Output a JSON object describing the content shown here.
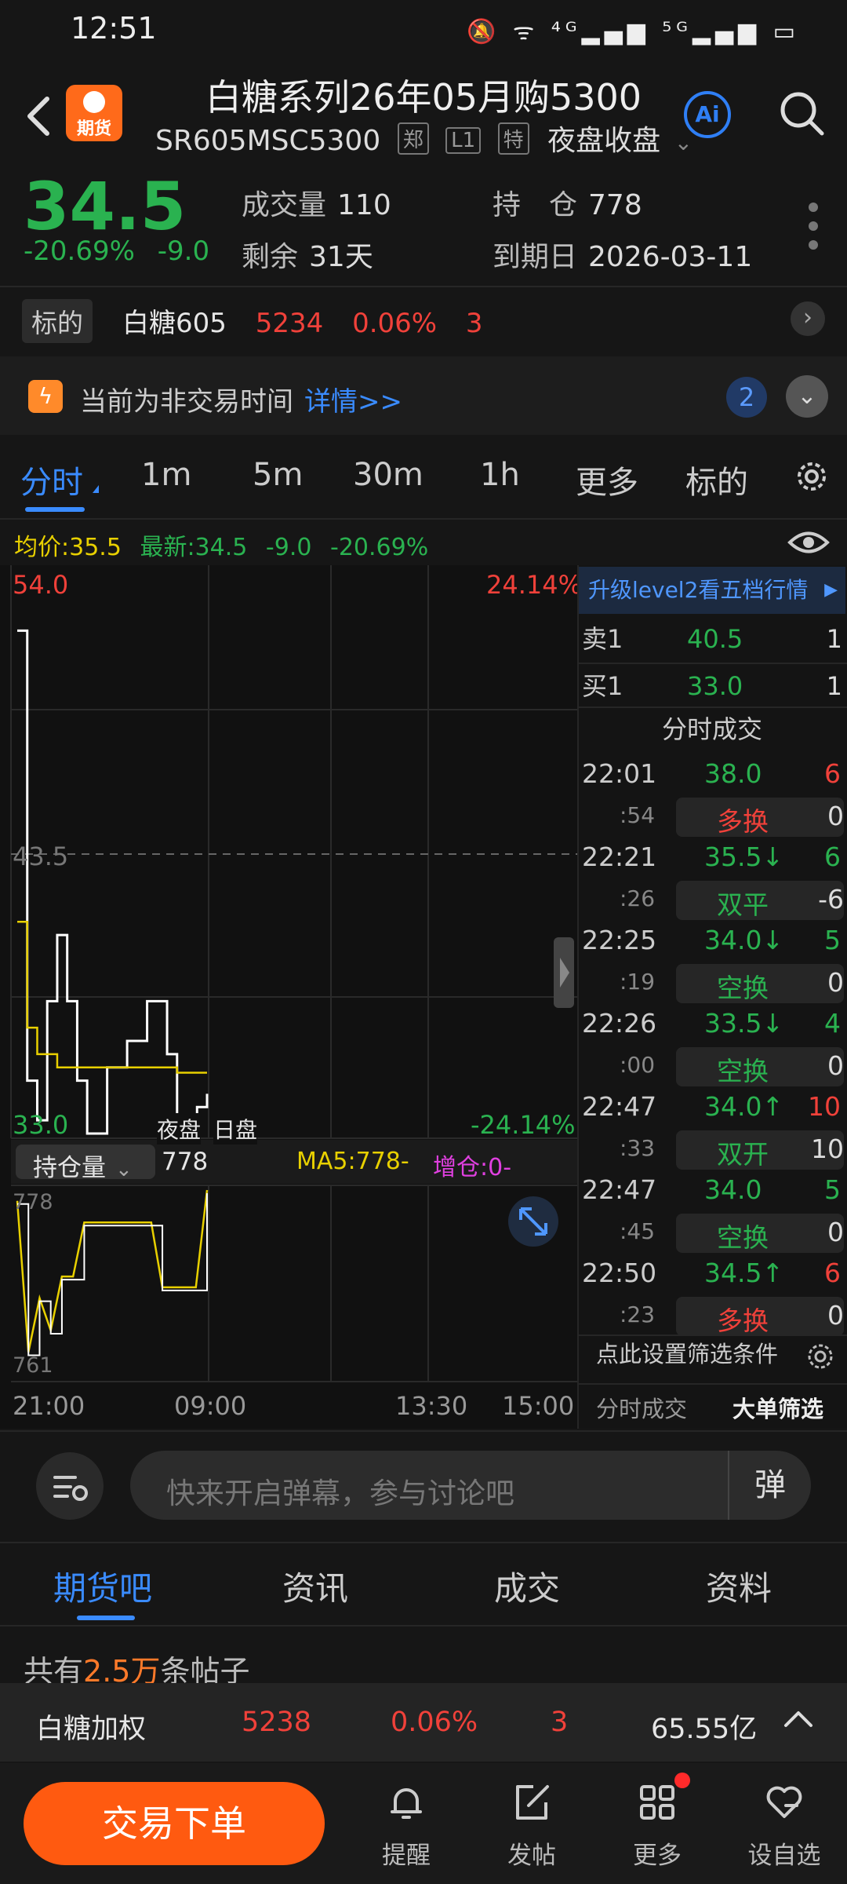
{
  "status_bar": {
    "time": "12:51",
    "icons": "🔕 ᯤ ⁴ᴳ▂▄▆ ⁵ᴳ▂▄▆ ▭"
  },
  "header": {
    "logo_text": "期货",
    "title": "白糖系列26年05月购5300",
    "code": "SR605MSC5300",
    "tags": [
      "郑",
      "L1",
      "特"
    ],
    "session": "夜盘收盘",
    "ai_label": "Ai"
  },
  "quote": {
    "price": "34.5",
    "change_pct": "-20.69%",
    "change": "-9.0",
    "volume_label": "成交量",
    "volume": "110",
    "oi_label": "持　仓",
    "oi": "778",
    "remaining_label": "剩余",
    "remaining": "31天",
    "expiry_label": "到期日",
    "expiry": "2026-03-11"
  },
  "underlying": {
    "tag": "标的",
    "name": "白糖605",
    "price": "5234",
    "pct": "0.06%",
    "change": "3"
  },
  "notice": {
    "text": "当前为非交易时间",
    "link": "详情>>",
    "badge": "2"
  },
  "period_tabs": [
    {
      "label": "分时"
    },
    {
      "label": "1m"
    },
    {
      "label": "5m"
    },
    {
      "label": "30m"
    },
    {
      "label": "1h"
    },
    {
      "label": "更多"
    },
    {
      "label": "标的"
    }
  ],
  "avg_line": {
    "avg": "均价:35.5",
    "latest": "最新:34.5",
    "change": "-9.0",
    "pct": "-20.69%"
  },
  "chart": {
    "top_left": "54.0",
    "top_right": "24.14%",
    "mid": "43.5",
    "bottom_left": "33.0",
    "bottom_right": "-24.14%",
    "session_night": "夜盘",
    "session_day": "日盘",
    "sub_selector": "持仓量",
    "sub_value": "778",
    "ma5": "MA5:778-",
    "zengcang": "增仓:0-",
    "sub_top": "778",
    "sub_bottom": "761",
    "x_labels": [
      "21:00",
      "09:00",
      "13:30",
      "15:00"
    ],
    "colors": {
      "price": "#ffffff",
      "avg": "#e8d000",
      "up": "#f0413a",
      "down": "#2ab250"
    }
  },
  "chart_data": {
    "type": "line",
    "title": "",
    "ylim": [
      33.0,
      54.0
    ],
    "reference": 43.5,
    "series": [
      {
        "values": [
          52.0,
          35.0,
          33.5,
          38.0,
          40.5,
          38.0,
          35.0,
          33.0,
          33.0,
          35.5,
          35.5,
          36.5,
          36.5,
          38.0,
          38.0,
          36.0,
          33.5,
          33.0,
          34.0,
          34.5
        ]
      },
      {
        "values": [
          41.0,
          37.0,
          36.0,
          36.0,
          35.5,
          35.5,
          35.5,
          35.5,
          35.5,
          35.5,
          35.5,
          35.5,
          35.5,
          35.5,
          35.5,
          35.5,
          35.3,
          35.3,
          35.3,
          35.3
        ]
      }
    ],
    "oi_ylim": [
      761,
      778
    ],
    "oi_values": [
      777,
      763,
      768,
      765,
      770,
      770,
      775,
      775,
      775,
      775,
      775,
      775,
      775,
      769,
      769,
      769,
      769,
      778
    ]
  },
  "orderbook": {
    "upgrade": "升级level2看五档行情",
    "rows": [
      {
        "label": "卖1",
        "price": "40.5",
        "vol": "1"
      },
      {
        "label": "买1",
        "price": "33.0",
        "vol": "1"
      }
    ]
  },
  "ticks": {
    "title": "分时成交",
    "rows": [
      {
        "time": "22:01",
        "sec": ":54",
        "price": "38.0",
        "arrow": "",
        "qty": "6",
        "kind": "多换",
        "kq": "0",
        "pc": "g",
        "qc": "r",
        "kc": "r"
      },
      {
        "time": "22:21",
        "sec": ":26",
        "price": "35.5↓",
        "arrow": "",
        "qty": "6",
        "kind": "双平",
        "kq": "-6",
        "pc": "g",
        "qc": "g",
        "kc": "g"
      },
      {
        "time": "22:25",
        "sec": ":19",
        "price": "34.0↓",
        "arrow": "",
        "qty": "5",
        "kind": "空换",
        "kq": "0",
        "pc": "g",
        "qc": "g",
        "kc": "g"
      },
      {
        "time": "22:26",
        "sec": ":00",
        "price": "33.5↓",
        "arrow": "",
        "qty": "4",
        "kind": "空换",
        "kq": "0",
        "pc": "g",
        "qc": "g",
        "kc": "g"
      },
      {
        "time": "22:47",
        "sec": ":33",
        "price": "34.0↑",
        "arrow": "",
        "qty": "10",
        "kind": "双开",
        "kq": "10",
        "pc": "g",
        "qc": "r",
        "kc": "g"
      },
      {
        "time": "22:47",
        "sec": ":45",
        "price": "34.0",
        "arrow": "",
        "qty": "5",
        "kind": "空换",
        "kq": "0",
        "pc": "g",
        "qc": "g",
        "kc": "g"
      },
      {
        "time": "22:50",
        "sec": ":23",
        "price": "34.5↑",
        "arrow": "",
        "qty": "6",
        "kind": "多换",
        "kq": "0",
        "pc": "g",
        "qc": "r",
        "kc": "r"
      }
    ],
    "filter": "点此设置筛选条件",
    "tab1": "分时成交",
    "tab2": "大单筛选"
  },
  "comment": {
    "placeholder": "快来开启弹幕，参与讨论吧",
    "danmu": "弹"
  },
  "section_tabs": [
    "期货吧",
    "资讯",
    "成交",
    "资料"
  ],
  "posts": {
    "prefix": "共有",
    "count": "2.5万",
    "suffix": "条帖子"
  },
  "index_bar": {
    "name": "白糖加权",
    "price": "5238",
    "pct": "0.06%",
    "change": "3",
    "amount": "65.55亿"
  },
  "bottom_nav": {
    "trade": "交易下单",
    "items": [
      "提醒",
      "发帖",
      "更多",
      "设自选"
    ]
  }
}
